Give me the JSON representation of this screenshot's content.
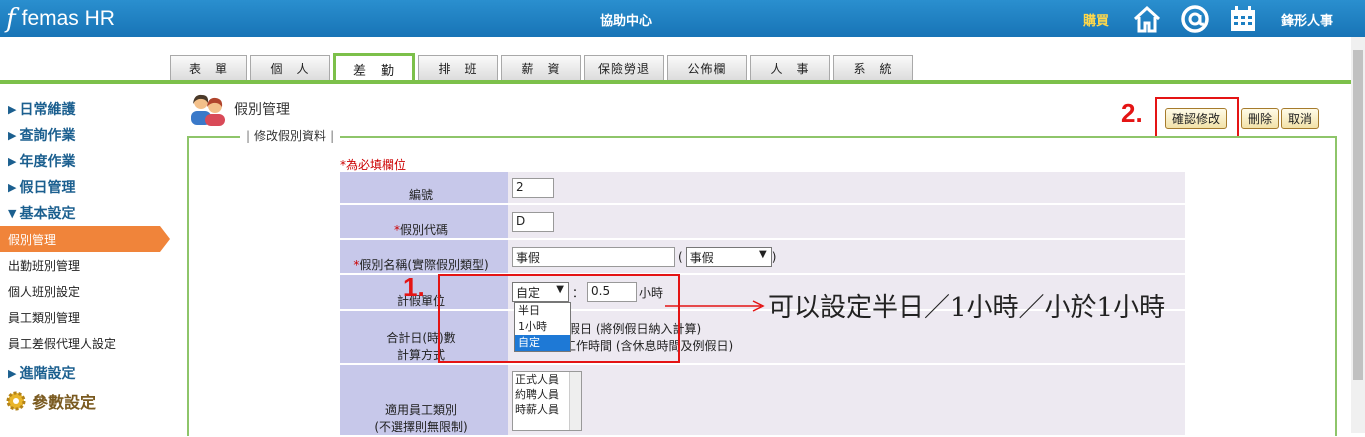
{
  "header": {
    "logo_text": "femas HR",
    "help_center": "協助中心",
    "buy": "購買",
    "company": "鋒形人事",
    "icons": [
      "home-icon",
      "at-icon",
      "calendar-icon"
    ],
    "colors": {
      "bar": "#1c7fc2",
      "accent": "#7cc04a"
    }
  },
  "tabs": [
    {
      "label": "表　單"
    },
    {
      "label": "個　人"
    },
    {
      "label": "差　勤",
      "active": true
    },
    {
      "label": "排　班"
    },
    {
      "label": "薪　資"
    },
    {
      "label": "保險勞退"
    },
    {
      "label": "公佈欄"
    },
    {
      "label": "人　事"
    },
    {
      "label": "系　統"
    }
  ],
  "sidebar": {
    "groups_top": [
      {
        "arrow": "▶",
        "label": "日常維護"
      },
      {
        "arrow": "▶",
        "label": "查詢作業"
      },
      {
        "arrow": "▶",
        "label": "年度作業"
      },
      {
        "arrow": "▶",
        "label": "假日管理"
      },
      {
        "arrow": "▼",
        "label": "基本設定"
      }
    ],
    "items": [
      {
        "label": "假別管理",
        "active": true
      },
      {
        "label": "出勤班別管理"
      },
      {
        "label": "個人班別設定"
      },
      {
        "label": "員工類別管理"
      },
      {
        "label": "員工差假代理人設定"
      }
    ],
    "advanced": {
      "arrow": "▶",
      "label": "進階設定"
    },
    "params": "參數設定"
  },
  "page": {
    "title": "假別管理",
    "legend": "修改假別資料",
    "required_note": "*為必填欄位"
  },
  "buttons": {
    "confirm": "確認修改",
    "delete": "刪除",
    "cancel": "取消"
  },
  "steps": {
    "one": "1.",
    "two": "2."
  },
  "annotation": "可以設定半日／1小時／小於1小時",
  "form": {
    "code_label": "編號",
    "code_value": "2",
    "leave_code_label": "假別代碼",
    "leave_code_value": "D",
    "leave_name_label": "假別名稱(實際假別類型)",
    "leave_name_value": "事假",
    "leave_type_select": "事假",
    "paren_open": "(",
    "paren_close": ")",
    "unit_label": "計假單位",
    "unit_select": "自定",
    "unit_options": [
      "半日",
      "1小時",
      "自定"
    ],
    "unit_colon": "：",
    "unit_value": "0.5",
    "unit_suffix": "小時",
    "calc_label_1": "合計日(時)數",
    "calc_label_2": "計算方式",
    "calc_text_1": "假日 (將例假日納入計算)",
    "calc_text_2": "計入非工作時間 (含休息時間及例假日)",
    "emp_label_1": "適用員工類別",
    "emp_label_2": "(不選擇則無限制)",
    "emp_options": [
      "正式人員",
      "約聘人員",
      "時薪人員"
    ]
  }
}
